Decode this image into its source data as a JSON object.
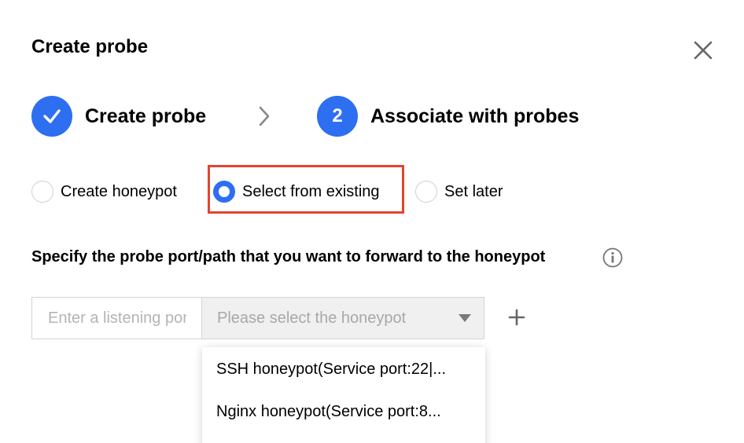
{
  "modal": {
    "title": "Create probe",
    "close_icon": "close-icon"
  },
  "steps": [
    {
      "label": "Create probe",
      "status": "done",
      "icon": "check-icon"
    },
    {
      "label": "Associate with probes",
      "status": "current",
      "number": "2"
    }
  ],
  "association": {
    "options": [
      {
        "label": "Create honeypot",
        "checked": false
      },
      {
        "label": "Select from existing",
        "checked": true
      },
      {
        "label": "Set later",
        "checked": false
      }
    ],
    "highlighted_option": "Select from existing"
  },
  "forward": {
    "label": "Specify the probe port/path that you want to forward to the honeypot",
    "info_icon": "info-icon",
    "port_placeholder": "Enter a listening port/path",
    "honeypot_placeholder": "Please select the honeypot",
    "add_icon": "plus-icon"
  },
  "dropdown": {
    "items": [
      "SSH honeypot(Service port:22|...",
      "Nginx honeypot(Service port:8..."
    ]
  },
  "colors": {
    "primary": "#2d6ff0",
    "highlight": "#e4442e"
  }
}
